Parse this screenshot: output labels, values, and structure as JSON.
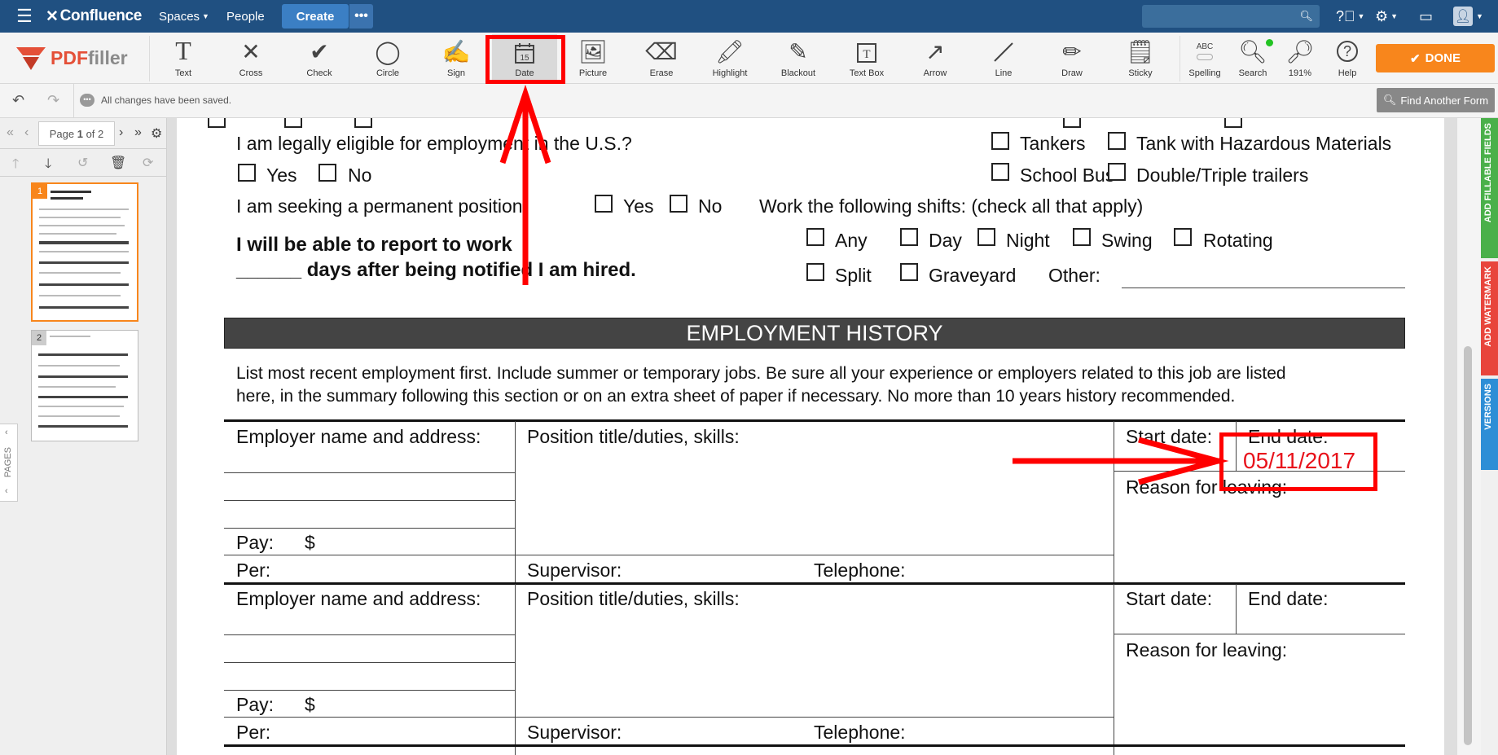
{
  "confluence": {
    "brand": "Confluence",
    "nav": {
      "spaces": "Spaces",
      "people": "People",
      "create": "Create",
      "more": "•••"
    }
  },
  "pdffiller": {
    "brand_pdf": "PDF",
    "brand_filler": "filler",
    "tools": [
      {
        "label": "Text",
        "icon": "text-tool-icon"
      },
      {
        "label": "Cross",
        "icon": "cross-icon"
      },
      {
        "label": "Check",
        "icon": "check-icon"
      },
      {
        "label": "Circle",
        "icon": "circle-icon"
      },
      {
        "label": "Sign",
        "icon": "sign-icon"
      },
      {
        "label": "Date",
        "icon": "calendar-icon",
        "day": "15"
      },
      {
        "label": "Picture",
        "icon": "picture-icon"
      },
      {
        "label": "Erase",
        "icon": "eraser-icon"
      },
      {
        "label": "Highlight",
        "icon": "highlight-icon"
      },
      {
        "label": "Blackout",
        "icon": "blackout-icon"
      },
      {
        "label": "Text Box",
        "icon": "text-box-icon"
      },
      {
        "label": "Arrow",
        "icon": "arrow-icon"
      },
      {
        "label": "Line",
        "icon": "line-icon"
      },
      {
        "label": "Draw",
        "icon": "draw-icon"
      },
      {
        "label": "Sticky",
        "icon": "sticky-icon"
      }
    ],
    "right_tools": [
      {
        "label": "Spelling",
        "icon_text": "ABC"
      },
      {
        "label": "Search"
      },
      {
        "label": "191%"
      },
      {
        "label": "Help",
        "icon_text": "?"
      }
    ],
    "done": "DONE",
    "status": "All changes have been saved.",
    "find_another_form": "Find Another Form"
  },
  "pager": {
    "prefix": "Page",
    "current": "1",
    "of": "of 2"
  },
  "pages_tab": "PAGES",
  "thumbs": [
    {
      "num": "1"
    },
    {
      "num": "2"
    }
  ],
  "side_tabs": {
    "fields": "ADD FILLABLE FIELDS",
    "watermark": "ADD WATERMARK",
    "versions": "VERSIONS"
  },
  "form": {
    "eligible": "I am legally eligible for employment in the U.S.?",
    "yes": "Yes",
    "no": "No",
    "permanent": "I am seeking a permanent position:",
    "report1": "I will be able to report to work",
    "report2": "______ days after being notified I am hired.",
    "tankers": "Tankers",
    "tank_haz": "Tank with Hazardous Materials",
    "school_bus": "School Bus",
    "double": "Double/Triple trailers",
    "shifts": "Work the following shifts: (check all that apply)",
    "any": "Any",
    "day": "Day",
    "night": "Night",
    "swing": "Swing",
    "rotating": "Rotating",
    "split": "Split",
    "graveyard": "Graveyard",
    "other": "Other:",
    "history_title": "EMPLOYMENT HISTORY",
    "intro1": "List most recent employment first. Include summer or temporary jobs. Be sure all your experience or employers related to this job are listed",
    "intro2": "here, in the summary following this section or on an extra sheet of paper if necessary. No more than 10 years history recommended.",
    "employer": "Employer name and address:",
    "position": "Position title/duties, skills:",
    "start": "Start date:",
    "end": "End date:",
    "reason": "Reason for leaving:",
    "pay": "Pay:",
    "dollar": "$",
    "per": "Per:",
    "supervisor": "Supervisor:",
    "telephone": "Telephone:",
    "end_date_value": "05/11/2017"
  },
  "colors": {
    "confluence_blue": "#205081",
    "done_orange": "#f8861c",
    "annotation_red": "#ff0000",
    "date_red": "#e8121b"
  }
}
